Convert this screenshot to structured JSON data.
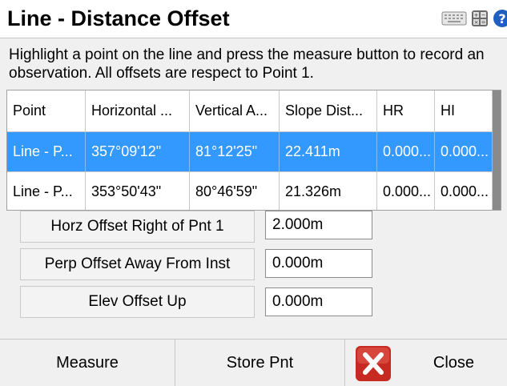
{
  "window": {
    "title": "Line - Distance Offset",
    "icons": [
      "keyboard-icon",
      "calculator-icon",
      "help-icon"
    ]
  },
  "instructions": "Highlight a point on the line and press the measure button to record an observation. All offsets are respect to Point 1.",
  "table": {
    "columns": [
      "Point",
      "Horizontal ...",
      "Vertical A...",
      "Slope Dist...",
      "HR",
      "HI"
    ],
    "rows": [
      [
        "Line - P...",
        "357°09'12\"",
        "81°12'25\"",
        "22.411m",
        "0.000...",
        "0.000..."
      ],
      [
        "Line - P...",
        "353°50'43\"",
        "80°46'59\"",
        "21.326m",
        "0.000...",
        "0.000..."
      ]
    ],
    "selected_row": 0
  },
  "offsets": [
    {
      "label": "Horz Offset Right of Pnt 1",
      "value": "2.000m"
    },
    {
      "label": "Perp Offset Away From Inst",
      "value": "0.000m"
    },
    {
      "label": "Elev Offset Up",
      "value": "0.000m"
    }
  ],
  "buttons": {
    "measure": "Measure",
    "store": "Store Pnt",
    "close": "Close"
  },
  "colors": {
    "selection": "#3399ff",
    "close_icon": "#d42a1f"
  }
}
